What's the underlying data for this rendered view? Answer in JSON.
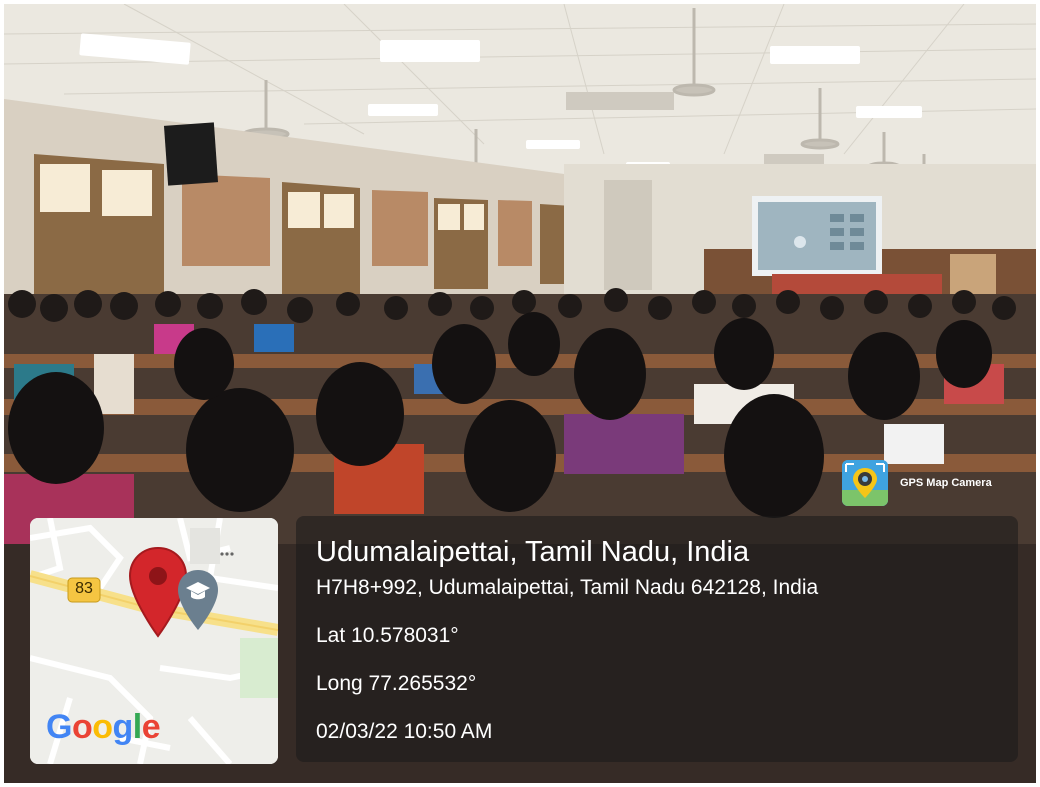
{
  "badge": {
    "app_name": "GPS Map Camera",
    "icon": "map-camera-icon"
  },
  "location": {
    "title": "Udumalaipettai, Tamil Nadu, India",
    "address": "H7H8+992, Udumalaipettai, Tamil Nadu 642128, India",
    "lat": "Lat 10.578031°",
    "long": "Long 77.265532°",
    "datetime": "02/03/22 10:50 AM"
  },
  "map": {
    "road_number": "83",
    "logo": "Google",
    "pin_color": "#d3262b",
    "marker_icon": "graduation-cap-icon"
  }
}
